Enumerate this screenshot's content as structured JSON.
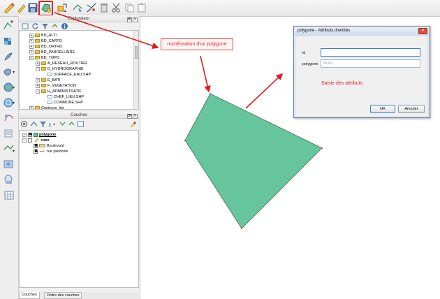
{
  "panels": {
    "browser": {
      "title": "Explorateur"
    },
    "layers": {
      "title": "Couches"
    },
    "title_button_float": "🗗",
    "title_button_close": "✕"
  },
  "browser_tree": [
    {
      "label": "BD_ALTI",
      "kind": "folder",
      "level": 1,
      "expander": "+"
    },
    {
      "label": "BD_CARTO",
      "kind": "folder",
      "level": 1,
      "expander": "+"
    },
    {
      "label": "BD_ORTHO",
      "kind": "folder",
      "level": 1,
      "expander": "+"
    },
    {
      "label": "BD_PARCELLAIRE",
      "kind": "folder",
      "level": 1,
      "expander": "+"
    },
    {
      "label": "BD_TOPO",
      "kind": "folder",
      "level": 1,
      "expander": "−"
    },
    {
      "label": "A_RESEAU_ROUTIER",
      "kind": "folder",
      "level": 2,
      "expander": "+"
    },
    {
      "label": "D_HYDROGRAPHIE",
      "kind": "folder",
      "level": 2,
      "expander": "−"
    },
    {
      "label": "SURFACE_EAU.SHP",
      "kind": "file",
      "level": 3,
      "expander": ""
    },
    {
      "label": "E_BATI",
      "kind": "folder",
      "level": 2,
      "expander": "+"
    },
    {
      "label": "F_VEGETATION",
      "kind": "folder",
      "level": 2,
      "expander": "+"
    },
    {
      "label": "H_ADMINISTRATIF",
      "kind": "folder",
      "level": 2,
      "expander": "−"
    },
    {
      "label": "CHEF_LIEU.SHP",
      "kind": "file",
      "level": 3,
      "expander": ""
    },
    {
      "label": "COMMUNE.SHP",
      "kind": "file",
      "level": 3,
      "expander": ""
    },
    {
      "label": "Contours_Iris",
      "kind": "folder",
      "level": 1,
      "expander": "+"
    }
  ],
  "layers": {
    "polygone": "polygone",
    "rues": "rues",
    "boulevard": "Boulevard",
    "rue_pietonne": "rue pietonne",
    "check_mark": "✖",
    "expander_minus": "−",
    "symbol_colors": {
      "polygone": "#66c29a",
      "boulevard": "#e5d9a0",
      "rue_pietonne": "#d83a3a"
    }
  },
  "bottom_tabs": [
    "Couches",
    "Ordre des couches"
  ],
  "map": {
    "polygon_fill": "#66c59c",
    "polygon_stroke": "#4a6e5c",
    "callout_digitize": "numérisation d'un polygone",
    "label_attributes": "Saisie des attributs",
    "arrow_color": "#e21b1b"
  },
  "dialog": {
    "title": "polygone - Attributs d'entités",
    "close_glyph": "✕",
    "fields": [
      {
        "label": "id",
        "value": "",
        "placeholder": ""
      },
      {
        "label": "polygone",
        "value": "",
        "placeholder": "NULL"
      }
    ],
    "ok_label": "OK",
    "cancel_label": "Annuler"
  },
  "icons": {
    "top_toolbar": [
      "pencil-edit-icon",
      "save-edits-icon",
      "add-polygon-icon",
      "add-feature-icon",
      "move-feature-icon",
      "node-tool-icon",
      "delete-selected-icon",
      "cut-features-icon",
      "copy-features-icon",
      "paste-features-icon"
    ],
    "left_toolbar": [
      "add-vector-layer-icon",
      "add-raster-layer-icon",
      "add-postgis-layer-icon",
      "add-spatialite-layer-icon",
      "add-wms-layer-icon",
      "add-wcs-layer-icon",
      "add-wfs-layer-icon",
      "add-csv-layer-icon",
      "add-mssql-layer-icon",
      "new-shapefile-icon",
      "add-delimited-text-icon",
      "add-virtual-layer-icon",
      "add-oracle-layer-icon"
    ]
  }
}
